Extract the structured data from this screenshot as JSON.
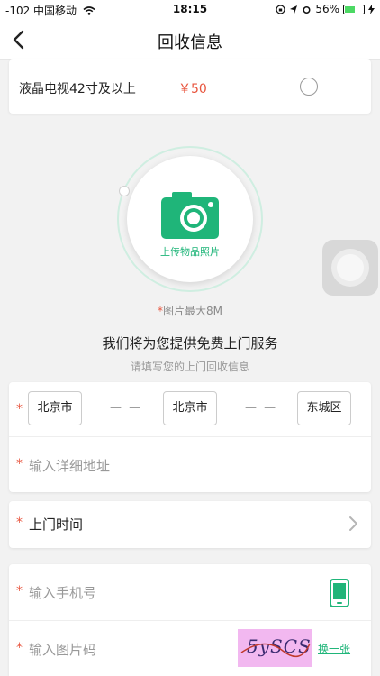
{
  "status": {
    "carrier": "-102 中国移动",
    "time": "18:15",
    "battery": "56%",
    "battery_level": 0.56
  },
  "nav": {
    "title": "回收信息"
  },
  "item": {
    "name": "液晶电视42寸及以上",
    "price": "￥50"
  },
  "upload": {
    "label": "上传物品照片",
    "hint_star": "*",
    "hint": "图片最大8M"
  },
  "service": {
    "title": "我们将为您提供免费上门服务",
    "subtitle": "请填写您的上门回收信息"
  },
  "address": {
    "province": "北京市",
    "city": "北京市",
    "district": "东城区",
    "separator": "— —",
    "detail_placeholder": "输入详细地址"
  },
  "visit_time": {
    "label": "上门时间"
  },
  "contact": {
    "phone_placeholder": "输入手机号",
    "captcha_placeholder": "输入图片码",
    "captcha_text": "5ySCS",
    "refresh_label": "换一张"
  },
  "required_mark": "*",
  "colors": {
    "accent": "#1fb579",
    "price": "#e8553e",
    "required": "#e8553e"
  }
}
